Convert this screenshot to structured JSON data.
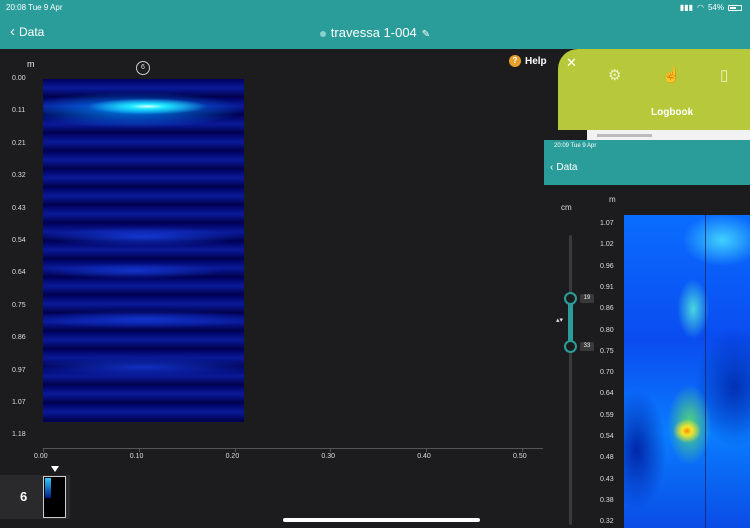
{
  "status_bar": {
    "time": "20:08  Tue 9 Apr",
    "battery": "54%"
  },
  "nav": {
    "back_label": "Data",
    "title": "travessa 1-004"
  },
  "help_label": "Help",
  "main_chart": {
    "y_unit": "m",
    "y_labels": [
      "0.00",
      "0.11",
      "0.21",
      "0.32",
      "0.43",
      "0.54",
      "0.64",
      "0.75",
      "0.86",
      "0.97",
      "1.07",
      "1.18"
    ],
    "x_labels": [
      "0.00",
      "0.10",
      "0.20",
      "0.30",
      "0.40",
      "0.50"
    ],
    "marker_label": "6"
  },
  "chart_data": {
    "type": "heatmap",
    "title": "",
    "xlabel": "",
    "ylabel": "m",
    "x_ticks": [
      0.0,
      0.1,
      0.2,
      0.3,
      0.4,
      0.5
    ],
    "y_ticks": [
      0.0,
      0.11,
      0.21,
      0.32,
      0.43,
      0.54,
      0.64,
      0.75,
      0.86,
      0.97,
      1.07,
      1.18
    ],
    "xlim": [
      0,
      0.5
    ],
    "ylim": [
      0,
      1.18
    ],
    "data_extent_x": [
      0,
      0.21
    ],
    "strong_reflection_depth": 0.1,
    "colormap": [
      "#000040",
      "#0033cc",
      "#00ccff",
      "#ffffff"
    ]
  },
  "thumbnail": {
    "number": "6"
  },
  "logbook": {
    "label": "Logbook"
  },
  "inset": {
    "time": "20:09  Tue 9 Apr",
    "back_label": "Data",
    "cm_unit": "cm",
    "m_unit": "m",
    "slider_top_value": "19",
    "slider_bottom_value": "33",
    "y_labels": [
      "1.07",
      "1.02",
      "0.96",
      "0.91",
      "0.86",
      "0.80",
      "0.75",
      "0.70",
      "0.64",
      "0.59",
      "0.54",
      "0.48",
      "0.43",
      "0.38",
      "0.32"
    ]
  },
  "colors": {
    "accent": "#2a9d9a",
    "logbook": "#b7c93a",
    "help": "#e4a12b",
    "background": "#1c1c1e"
  }
}
